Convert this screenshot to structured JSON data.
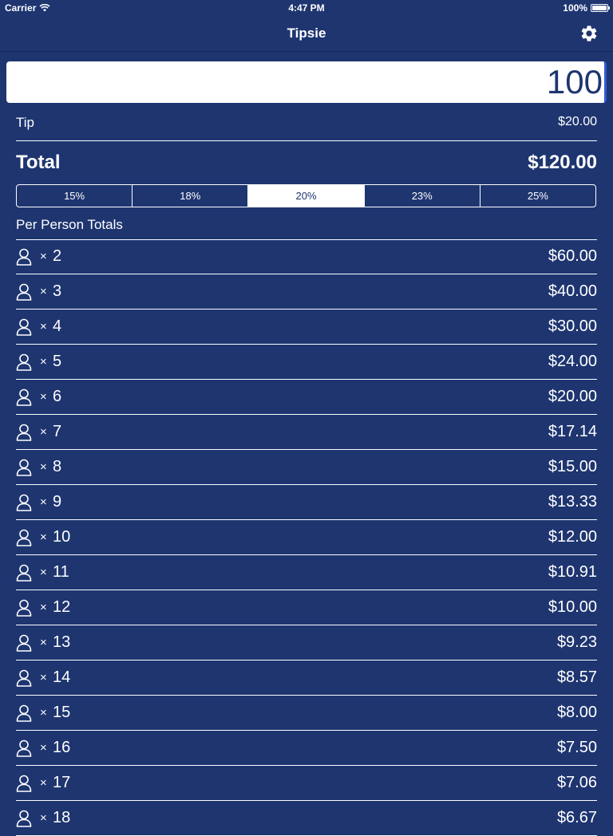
{
  "status_bar": {
    "carrier": "Carrier",
    "time": "4:47 PM",
    "battery": "100%"
  },
  "nav": {
    "title": "Tipsie",
    "settings_icon": "gear-icon"
  },
  "bill": {
    "value": "100"
  },
  "tip": {
    "label": "Tip",
    "value": "$20.00"
  },
  "total": {
    "label": "Total",
    "value": "$120.00"
  },
  "tip_options": {
    "items": [
      "15%",
      "18%",
      "20%",
      "23%",
      "25%"
    ],
    "selected": "20%"
  },
  "per_person": {
    "header": "Per Person Totals",
    "times_symbol": "×",
    "icon": "person-icon",
    "rows": [
      {
        "count": "2",
        "amount": "$60.00"
      },
      {
        "count": "3",
        "amount": "$40.00"
      },
      {
        "count": "4",
        "amount": "$30.00"
      },
      {
        "count": "5",
        "amount": "$24.00"
      },
      {
        "count": "6",
        "amount": "$20.00"
      },
      {
        "count": "7",
        "amount": "$17.14"
      },
      {
        "count": "8",
        "amount": "$15.00"
      },
      {
        "count": "9",
        "amount": "$13.33"
      },
      {
        "count": "10",
        "amount": "$12.00"
      },
      {
        "count": "11",
        "amount": "$10.91"
      },
      {
        "count": "12",
        "amount": "$10.00"
      },
      {
        "count": "13",
        "amount": "$9.23"
      },
      {
        "count": "14",
        "amount": "$8.57"
      },
      {
        "count": "15",
        "amount": "$8.00"
      },
      {
        "count": "16",
        "amount": "$7.50"
      },
      {
        "count": "17",
        "amount": "$7.06"
      },
      {
        "count": "18",
        "amount": "$6.67"
      }
    ]
  },
  "colors": {
    "background": "#1e3570",
    "foreground": "#ffffff"
  }
}
